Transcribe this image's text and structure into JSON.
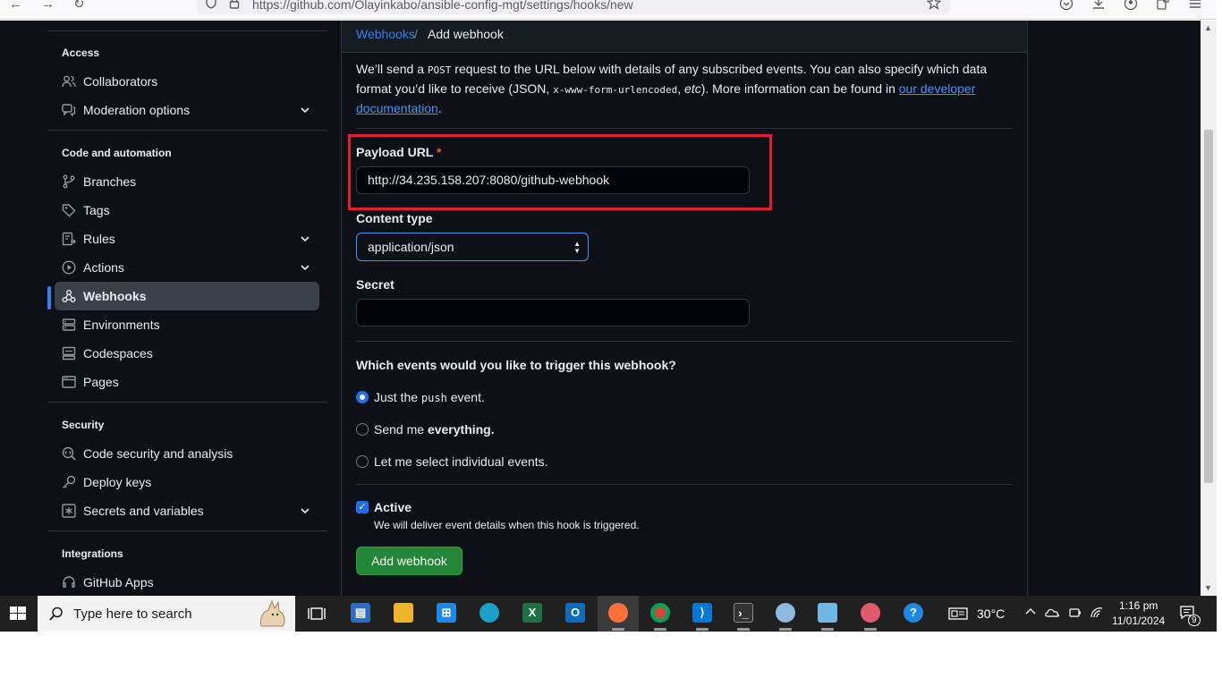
{
  "browser": {
    "back": "←",
    "forward": "→",
    "reload": "↻",
    "url": "https://github.com/Olayinkabo/ansible-config-mgt/settings/hooks/new"
  },
  "sidebar": {
    "sections": [
      {
        "heading": "Access"
      },
      {
        "heading": "Code and automation"
      },
      {
        "heading": "Security"
      },
      {
        "heading": "Integrations"
      }
    ],
    "items": [
      {
        "label": "Collaborators",
        "icon": "people-icon"
      },
      {
        "label": "Moderation options",
        "icon": "comment-icon",
        "expandable": true
      },
      {
        "label": "Branches",
        "icon": "branch-icon"
      },
      {
        "label": "Tags",
        "icon": "tag-icon"
      },
      {
        "label": "Rules",
        "icon": "rules-icon",
        "expandable": true
      },
      {
        "label": "Actions",
        "icon": "play-icon",
        "expandable": true
      },
      {
        "label": "Webhooks",
        "icon": "webhook-icon",
        "active": true
      },
      {
        "label": "Environments",
        "icon": "server-icon"
      },
      {
        "label": "Codespaces",
        "icon": "codespaces-icon"
      },
      {
        "label": "Pages",
        "icon": "browser-icon"
      },
      {
        "label": "Code security and analysis",
        "icon": "codescan-icon"
      },
      {
        "label": "Deploy keys",
        "icon": "key-icon"
      },
      {
        "label": "Secrets and variables",
        "icon": "asterisk-icon",
        "expandable": true
      },
      {
        "label": "GitHub Apps",
        "icon": "apps-icon"
      }
    ]
  },
  "header": {
    "breadcrumb_link": "Webhooks",
    "breadcrumb_sep": "/",
    "breadcrumb_current": "Add webhook"
  },
  "intro": {
    "p1": "We’ll send a ",
    "post": "POST",
    "p2": " request to the URL below with details of any subscribed events. You can also specify which data format you’d like to receive (JSON, ",
    "format": "x-www-form-urlencoded",
    "p3": ", ",
    "etc": "etc",
    "p4": "). More information can be found in ",
    "link": "our developer documentation",
    "p5": "."
  },
  "form": {
    "payload_label": "Payload URL",
    "payload_required": "*",
    "payload_value": "http://34.235.158.207:8080/github-webhook",
    "content_type_label": "Content type",
    "content_type_value": "application/json",
    "secret_label": "Secret",
    "secret_value": "",
    "events_question": "Which events would you like to trigger this webhook?",
    "events": [
      {
        "prefix": "Just the ",
        "code": "push",
        "suffix": " event.",
        "selected": true
      },
      {
        "prefix": "Send me ",
        "bold": "everything.",
        "selected": false
      },
      {
        "prefix": "Let me select individual events.",
        "selected": false
      }
    ],
    "active_label": "Active",
    "active_checked": true,
    "active_note": "We will deliver event details when this hook is triggered.",
    "submit_label": "Add webhook"
  },
  "taskbar": {
    "search_placeholder": "Type here to search",
    "weather": "30°C",
    "time": "1:16 pm",
    "date": "11/01/2024",
    "notifications": "9"
  },
  "colors": {
    "accent": "#2f81f7",
    "success": "#238636",
    "highlight": "#e0202a",
    "background": "#0d1117"
  }
}
